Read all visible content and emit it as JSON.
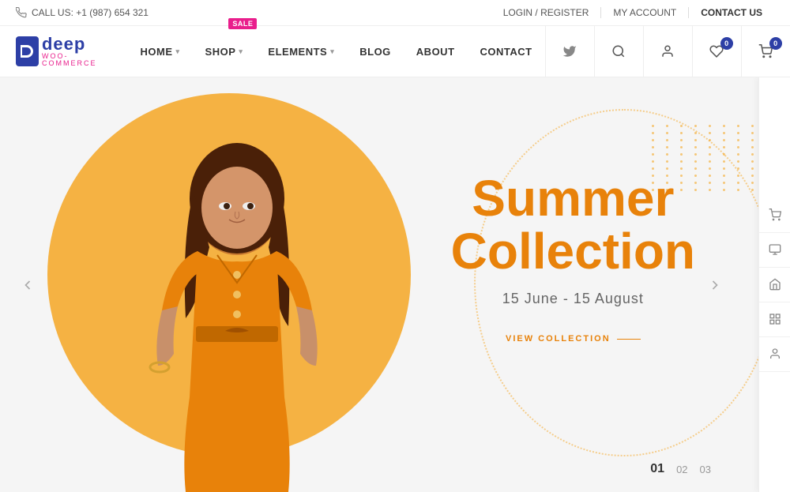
{
  "topbar": {
    "phone_label": "CALL US: +1 (987) 654 321",
    "login_label": "LOGIN / REGISTER",
    "account_label": "MY ACCOUNT",
    "contact_label": "CONTACT US"
  },
  "logo": {
    "name": "deep",
    "sub": "WOO-COMMERCE",
    "icon_letter": "D"
  },
  "nav": {
    "items": [
      {
        "label": "HOME",
        "has_dropdown": true
      },
      {
        "label": "SHOP",
        "has_dropdown": true,
        "has_sale": true
      },
      {
        "label": "ELEMENTS",
        "has_dropdown": true
      },
      {
        "label": "BLOG",
        "has_dropdown": false
      },
      {
        "label": "ABOUT",
        "has_dropdown": false
      },
      {
        "label": "CONTACT",
        "has_dropdown": false
      }
    ],
    "wishlist_count": "0",
    "cart_count": "0"
  },
  "hero": {
    "title_line1": "Summer",
    "title_line2": "Collection",
    "date_range": "15 June - 15 August",
    "cta_label": "VIEW COLLECTION",
    "slide_indicators": [
      "01",
      "02",
      "03"
    ],
    "active_slide": 0
  },
  "sidebar": {
    "icons": [
      "cart",
      "monitor",
      "home",
      "grid",
      "user"
    ]
  },
  "colors": {
    "orange": "#e8820a",
    "blue": "#2d3fa6",
    "pink": "#e91e8c"
  }
}
